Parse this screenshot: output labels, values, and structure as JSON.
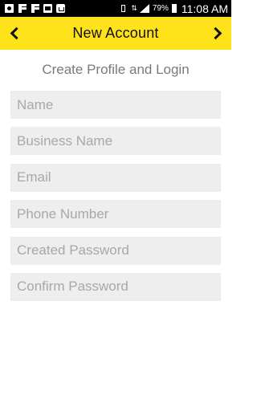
{
  "status_bar": {
    "battery_percent": "79%",
    "time": "11:08 AM"
  },
  "app_bar": {
    "title": "New Account",
    "back_icon": "chevron-left-icon",
    "forward_icon": "chevron-right-icon",
    "background_color": "#FFE31A"
  },
  "form": {
    "heading": "Create Profile and Login",
    "fields": [
      {
        "placeholder": "Name",
        "value": ""
      },
      {
        "placeholder": "Business Name",
        "value": ""
      },
      {
        "placeholder": "Email",
        "value": ""
      },
      {
        "placeholder": "Phone Number",
        "value": ""
      },
      {
        "placeholder": "Created Password",
        "value": ""
      },
      {
        "placeholder": "Confirm Password",
        "value": ""
      }
    ]
  }
}
